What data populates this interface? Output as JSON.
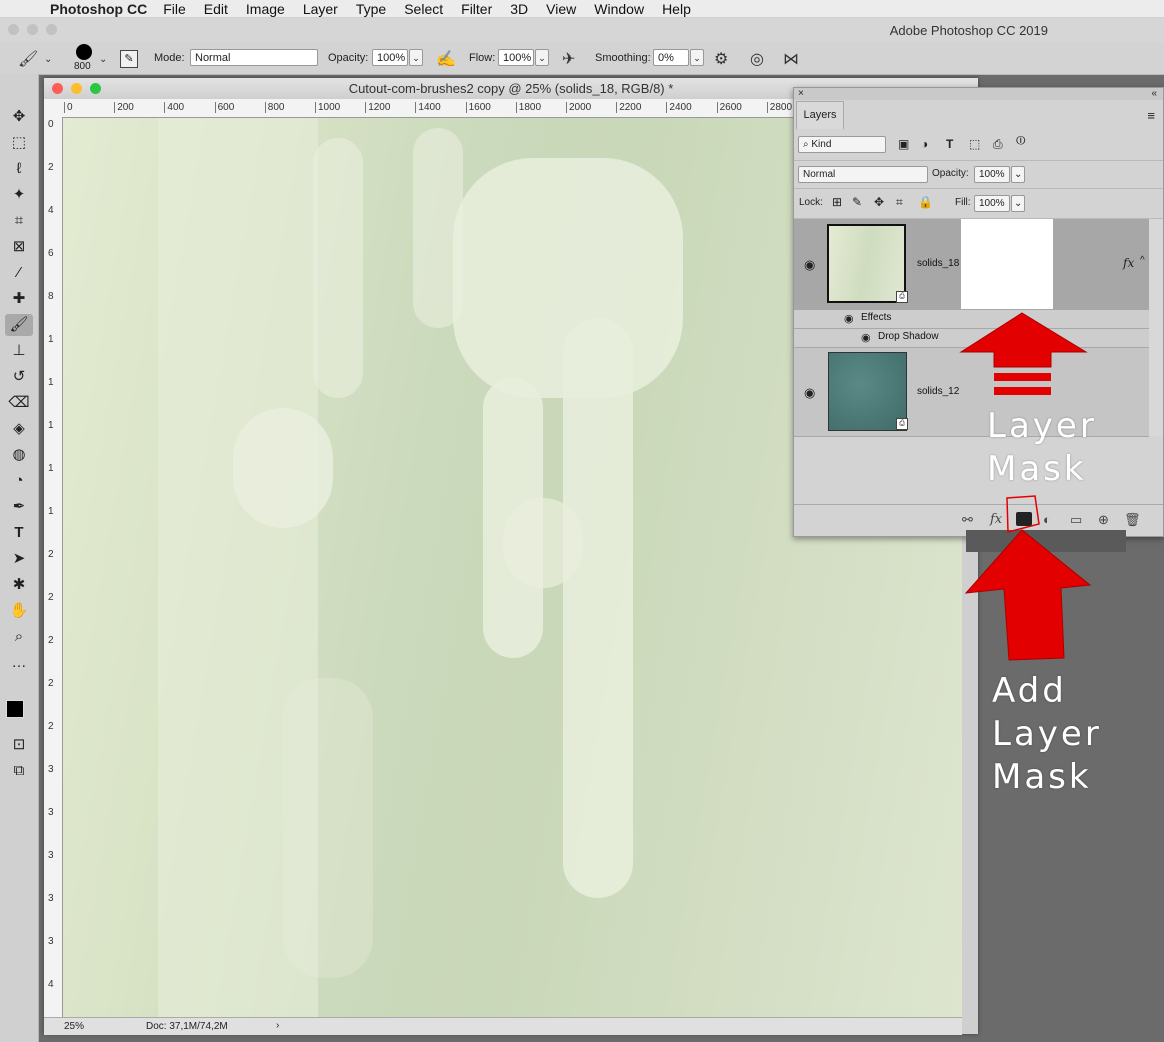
{
  "menubar": {
    "app_name": "Photoshop CC",
    "items": [
      "File",
      "Edit",
      "Image",
      "Layer",
      "Type",
      "Select",
      "Filter",
      "3D",
      "View",
      "Window",
      "Help"
    ],
    "window_title": "Adobe Photoshop CC 2019"
  },
  "options_bar": {
    "brush_size": "800",
    "mode_label": "Mode:",
    "mode_value": "Normal",
    "opacity_label": "Opacity:",
    "opacity_value": "100%",
    "flow_label": "Flow:",
    "flow_value": "100%",
    "smoothing_label": "Smoothing:",
    "smoothing_value": "0%"
  },
  "document": {
    "title": "Cutout-com-brushes2 copy @ 25% (solids_18, RGB/8) *",
    "ruler_h": [
      "0",
      "200",
      "400",
      "600",
      "800",
      "1000",
      "1200",
      "1400",
      "1600",
      "1800",
      "2000",
      "2200",
      "2400",
      "2600",
      "2800"
    ],
    "ruler_v": [
      "0",
      "2",
      "4",
      "6",
      "8",
      "1",
      "1",
      "1",
      "1",
      "1",
      "2",
      "2",
      "2",
      "2",
      "2",
      "3",
      "3",
      "3",
      "3",
      "3",
      "4"
    ],
    "zoom": "25%",
    "doc_size": "Doc: 37,1M/74,2M"
  },
  "layers_panel": {
    "tab_label": "Layers",
    "filter_kind": "Kind",
    "blend_mode": "Normal",
    "opacity_label": "Opacity:",
    "opacity_value": "100%",
    "lock_label": "Lock:",
    "fill_label": "Fill:",
    "fill_value": "100%",
    "layers": [
      {
        "name": "solids_18",
        "fx": "fx",
        "effects_label": "Effects",
        "effect": "Drop Shadow"
      },
      {
        "name": "solids_12"
      }
    ]
  },
  "annotations": {
    "layer_mask": [
      "Layer",
      "Mask"
    ],
    "add_layer_mask": [
      "Add",
      "Layer",
      "Mask"
    ]
  },
  "colors": {
    "annotation_arrow": "#e30000",
    "canvas_base": "#cfdcbf",
    "teal_thumb": "#4f7e7b"
  }
}
